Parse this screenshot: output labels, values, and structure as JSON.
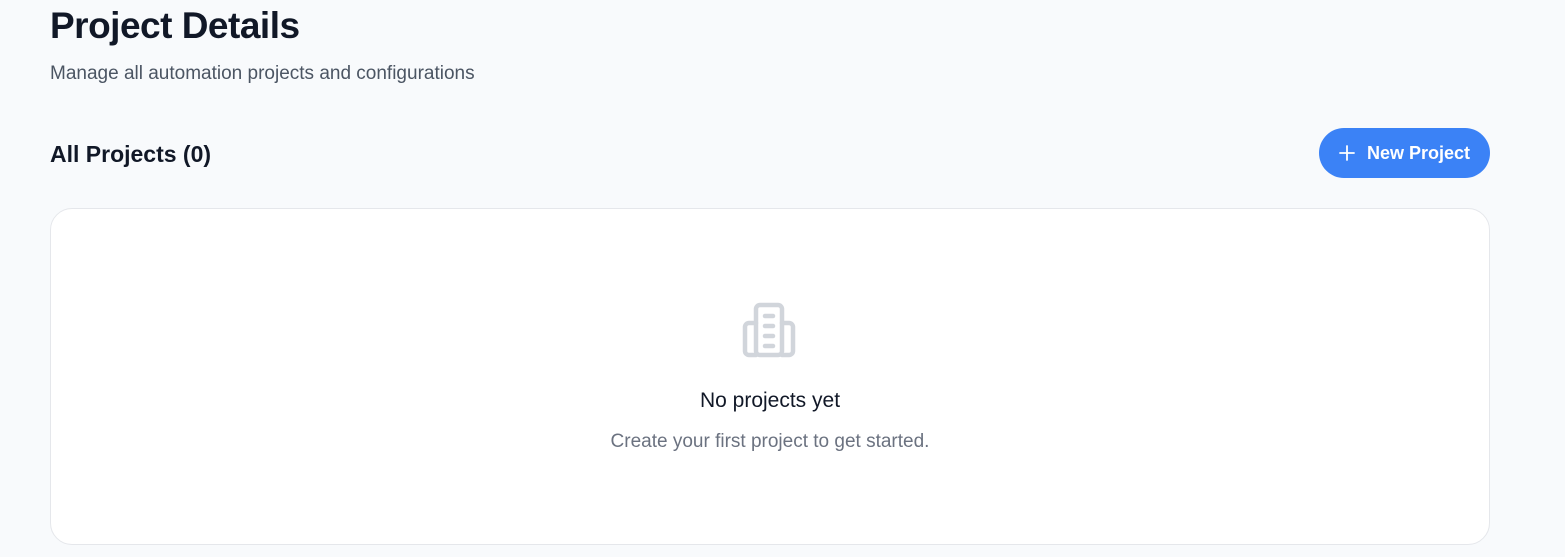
{
  "header": {
    "title": "Project Details",
    "subtitle": "Manage all automation projects and configurations"
  },
  "projects_section": {
    "title": "All Projects (0)",
    "new_button_label": "New Project",
    "new_button_icon": "plus-icon",
    "accent_color": "#3b82f6"
  },
  "empty_state": {
    "icon": "building-icon",
    "title": "No projects yet",
    "description": "Create your first project to get started."
  }
}
